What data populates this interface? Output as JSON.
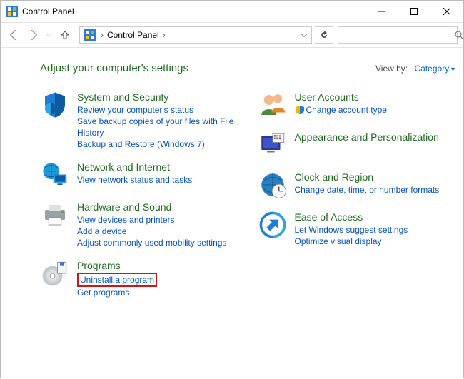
{
  "titlebar": {
    "title": "Control Panel"
  },
  "nav": {
    "crumb": "Control Panel",
    "search_placeholder": ""
  },
  "header": {
    "heading": "Adjust your computer's settings",
    "viewby_label": "View by:",
    "viewby_value": "Category"
  },
  "categories": {
    "system": {
      "name": "System and Security",
      "links": [
        "Review your computer's status",
        "Save backup copies of your files with File History",
        "Backup and Restore (Windows 7)"
      ]
    },
    "network": {
      "name": "Network and Internet",
      "links": [
        "View network status and tasks"
      ]
    },
    "hardware": {
      "name": "Hardware and Sound",
      "links": [
        "View devices and printers",
        "Add a device",
        "Adjust commonly used mobility settings"
      ]
    },
    "programs": {
      "name": "Programs",
      "links": [
        "Uninstall a program",
        "Get programs"
      ]
    },
    "users": {
      "name": "User Accounts",
      "links": [
        "Change account type"
      ]
    },
    "appearance": {
      "name": "Appearance and Personalization",
      "links": []
    },
    "clock": {
      "name": "Clock and Region",
      "links": [
        "Change date, time, or number formats"
      ]
    },
    "ease": {
      "name": "Ease of Access",
      "links": [
        "Let Windows suggest settings",
        "Optimize visual display"
      ]
    }
  }
}
